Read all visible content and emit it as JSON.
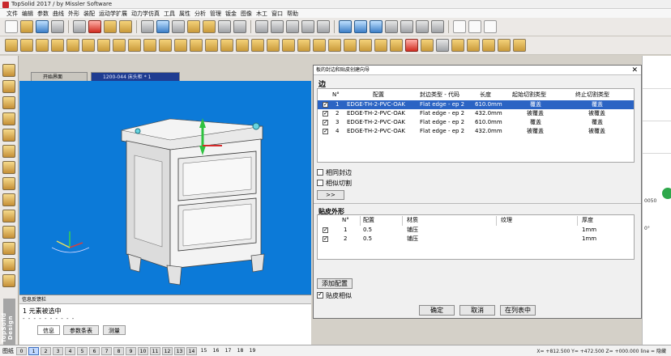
{
  "title": "TopSolid 2017 / by Missler Software",
  "menu": [
    "文件",
    "编辑",
    "参数",
    "曲线",
    "外形",
    "装配",
    "运动学扩展",
    "动力学仿真",
    "工具",
    "属性",
    "分析",
    "管理",
    "钣金",
    "图像",
    "木工",
    "窗口",
    "帮助"
  ],
  "doc_tabs": [
    "开始界面",
    "1200-044 床头柜 * 1"
  ],
  "dialog": {
    "title": "板的封边和贴皮创建向导",
    "edges_label": "边",
    "columns": [
      "N°",
      "配置",
      "封边类型 - 代码",
      "长度",
      "起始切割类型",
      "终止切割类型"
    ],
    "rows": [
      {
        "n": "1",
        "config": "EDGE-TH-2-PVC-OAK",
        "type": "Flat edge - ep 2",
        "length": "610.0mm",
        "start": "覆盖",
        "end": "覆盖",
        "checked": true
      },
      {
        "n": "2",
        "config": "EDGE-TH-2-PVC-OAK",
        "type": "Flat edge - ep 2",
        "length": "432.0mm",
        "start": "被覆盖",
        "end": "被覆盖",
        "checked": true
      },
      {
        "n": "3",
        "config": "EDGE-TH-2-PVC-OAK",
        "type": "Flat edge - ep 2",
        "length": "610.0mm",
        "start": "覆盖",
        "end": "覆盖",
        "checked": true
      },
      {
        "n": "4",
        "config": "EDGE-TH-2-PVC-OAK",
        "type": "Flat edge - ep 2",
        "length": "432.0mm",
        "start": "被覆盖",
        "end": "被覆盖",
        "checked": true
      }
    ],
    "same_edge_label": "相同封边",
    "same_cut_label": "相似切割",
    "more_label": ">>",
    "veneer_label": "贴皮外形",
    "veneer_columns": [
      "N°",
      "配置",
      "材质",
      "纹理",
      "厚度"
    ],
    "veneer_rows": [
      {
        "n": "1",
        "config": "0.5",
        "material": "铺压",
        "grain": "",
        "thickness": "1mm",
        "checked": true
      },
      {
        "n": "2",
        "config": "0.5",
        "material": "铺压",
        "grain": "",
        "thickness": "1mm",
        "checked": true
      }
    ],
    "add_config_label": "添加配置",
    "veneer_check_label": "贴皮相似",
    "ok_label": "确定",
    "cancel_label": "取消",
    "inlist_label": "在列表中"
  },
  "info_panel": {
    "header": "信息反馈栏",
    "line": "1 元素被选中",
    "dashes": "- - - - - - - - - -",
    "tabs": [
      "信息",
      "参数条表",
      "测量"
    ]
  },
  "brand_text": "TopSolid Design",
  "status": {
    "label": "图纸",
    "pages": [
      "0",
      "1",
      "2",
      "3",
      "4",
      "5",
      "6",
      "7",
      "8",
      "9",
      "10",
      "11",
      "12",
      "13",
      "14",
      "15",
      "16",
      "17",
      "18",
      "19"
    ],
    "coords": "X= +812.500  Y= +472.500  Z= +000.000  line = 隐藏"
  },
  "right_strip": [
    "0050",
    "0°"
  ],
  "colors": {
    "viewport": "#0c7ad8",
    "selection": "#2b64c4",
    "active_tab": "#1f3c91"
  }
}
